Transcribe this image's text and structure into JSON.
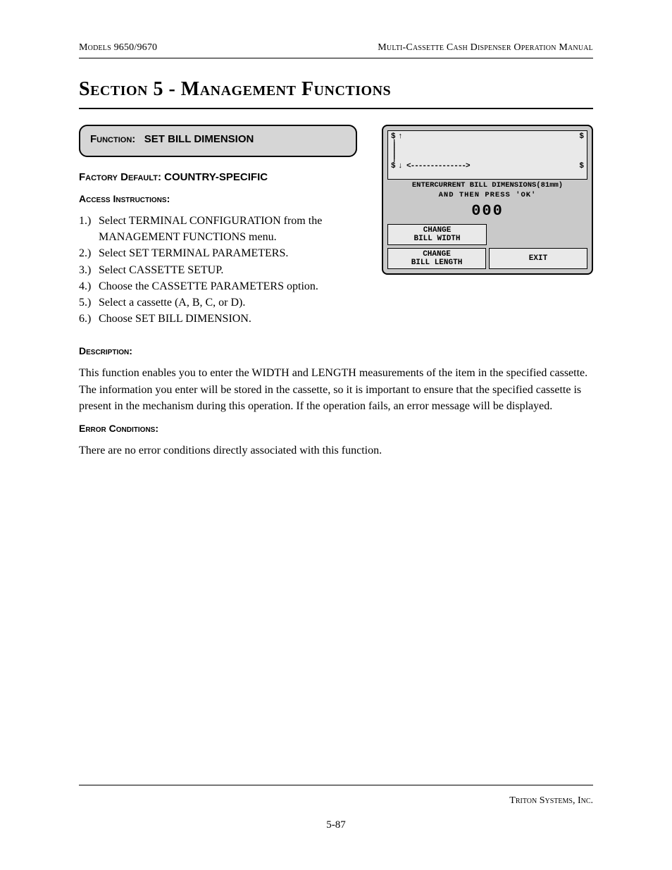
{
  "header": {
    "left": "Models 9650/9670",
    "right": "Multi-Cassette Cash Dispenser Operation Manual"
  },
  "section_title": "Section 5 - Management Functions",
  "function_box": {
    "label_prefix": "Function:",
    "label_value": "SET BILL DIMENSION"
  },
  "factory_default_label": "Factory Default:",
  "factory_default_value": "COUNTRY-SPECIFIC",
  "access_instructions_label": "Access Instructions:",
  "steps": [
    "Select TERMINAL CONFIGURATION from the MANAGEMENT FUNCTIONS menu.",
    "Select SET TERMINAL PARAMETERS.",
    "Select CASSETTE SETUP.",
    "Choose the CASSETTE PARAMETERS option.",
    "Select a cassette (A, B, C, or D).",
    "Choose SET BILL DIMENSION."
  ],
  "description_label": "Description:",
  "description_text": "This function enables you to enter the WIDTH and LENGTH  measurements of the item in the specified cassette.  The information you enter will be stored in the cassette, so it is important to ensure that the specified cassette is present in the mechanism during this operation. If the operation fails, an error message will be displayed.",
  "error_conditions_label": "Error Conditions:",
  "error_conditions_text": "There are no error conditions directly associated with this function.",
  "atm": {
    "line1": "ENTERCURRENT BILL DIMENSIONS(81mm)",
    "line2": "AND THEN PRESS 'OK'",
    "value": "000",
    "btn_width_l1": "CHANGE",
    "btn_width_l2": "BILL WIDTH",
    "btn_length_l1": "CHANGE",
    "btn_length_l2": "BILL LENGTH",
    "btn_exit": "EXIT"
  },
  "footer": {
    "company": "Triton Systems, Inc.",
    "page": "5-87"
  }
}
